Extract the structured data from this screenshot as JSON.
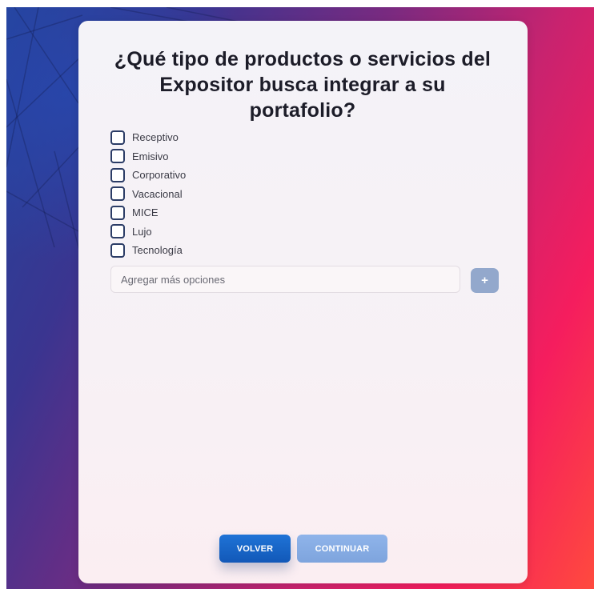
{
  "question": {
    "title": "¿Qué tipo de productos o servicios del Expositor busca integrar a su portafolio?"
  },
  "options": [
    {
      "label": "Receptivo",
      "checked": false
    },
    {
      "label": "Emisivo",
      "checked": false
    },
    {
      "label": "Corporativo",
      "checked": false
    },
    {
      "label": "Vacacional",
      "checked": false
    },
    {
      "label": "MICE",
      "checked": false
    },
    {
      "label": "Lujo",
      "checked": false
    },
    {
      "label": "Tecnología",
      "checked": false
    }
  ],
  "add_option": {
    "placeholder": "Agregar más opciones",
    "value": "",
    "button_label": "+"
  },
  "footer": {
    "back_label": "VOLVER",
    "continue_label": "CONTINUAR"
  },
  "colors": {
    "primary_button": "#1565c8",
    "disabled_button": "#86aae2",
    "add_button": "#93a8cc",
    "checkbox_border": "#2b3c66"
  }
}
